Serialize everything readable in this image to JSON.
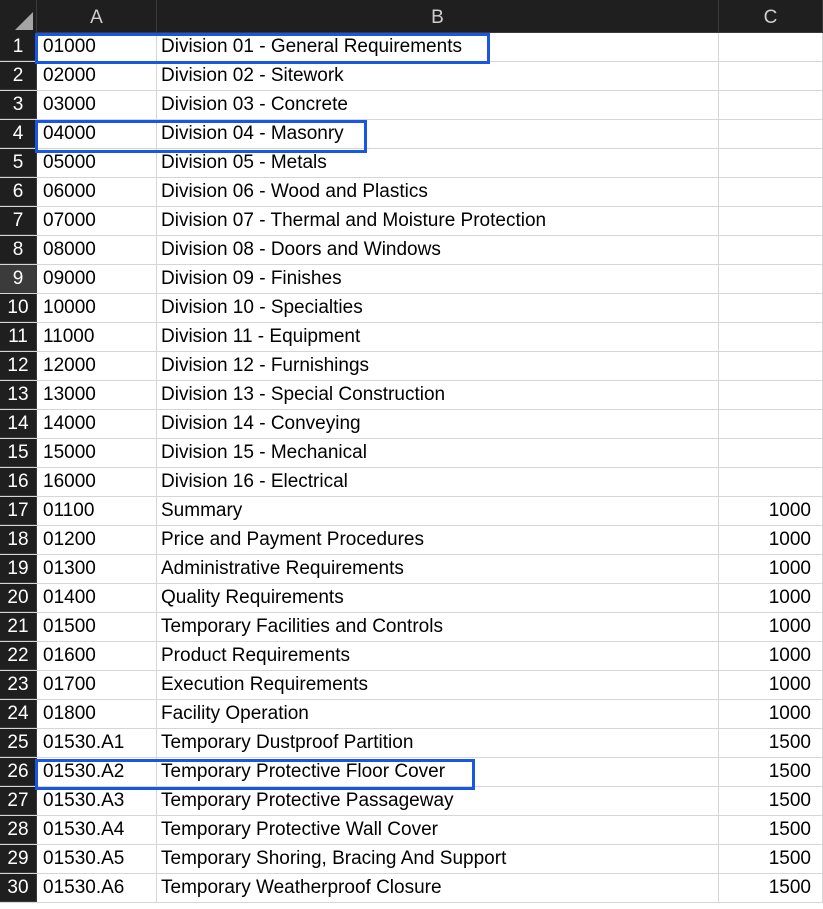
{
  "columns": [
    "A",
    "B",
    "C"
  ],
  "accent_color": "#1857e3",
  "rows": [
    {
      "n": "1",
      "a": "01000",
      "b": "Division 01 - General Requirements",
      "c": ""
    },
    {
      "n": "2",
      "a": "02000",
      "b": "Division 02 - Sitework",
      "c": ""
    },
    {
      "n": "3",
      "a": "03000",
      "b": "Division 03 - Concrete",
      "c": ""
    },
    {
      "n": "4",
      "a": "04000",
      "b": "Division 04 - Masonry",
      "c": ""
    },
    {
      "n": "5",
      "a": "05000",
      "b": "Division 05 - Metals",
      "c": ""
    },
    {
      "n": "6",
      "a": "06000",
      "b": "Division 06 - Wood and Plastics",
      "c": ""
    },
    {
      "n": "7",
      "a": "07000",
      "b": "Division 07 - Thermal and Moisture Protection",
      "c": ""
    },
    {
      "n": "8",
      "a": "08000",
      "b": "Division 08 - Doors and Windows",
      "c": ""
    },
    {
      "n": "9",
      "a": "09000",
      "b": "Division 09 - Finishes",
      "c": ""
    },
    {
      "n": "10",
      "a": "10000",
      "b": "Division 10 - Specialties",
      "c": ""
    },
    {
      "n": "11",
      "a": "11000",
      "b": "Division 11 - Equipment",
      "c": ""
    },
    {
      "n": "12",
      "a": "12000",
      "b": "Division 12 - Furnishings",
      "c": ""
    },
    {
      "n": "13",
      "a": "13000",
      "b": "Division 13 - Special Construction",
      "c": ""
    },
    {
      "n": "14",
      "a": "14000",
      "b": "Division 14 - Conveying",
      "c": ""
    },
    {
      "n": "15",
      "a": "15000",
      "b": "Division 15 - Mechanical",
      "c": ""
    },
    {
      "n": "16",
      "a": "16000",
      "b": "Division 16 - Electrical",
      "c": ""
    },
    {
      "n": "17",
      "a": "01100",
      "b": "Summary",
      "c": "1000"
    },
    {
      "n": "18",
      "a": "01200",
      "b": "Price and Payment Procedures",
      "c": "1000"
    },
    {
      "n": "19",
      "a": "01300",
      "b": "Administrative Requirements",
      "c": "1000"
    },
    {
      "n": "20",
      "a": "01400",
      "b": "Quality Requirements",
      "c": "1000"
    },
    {
      "n": "21",
      "a": "01500",
      "b": "Temporary Facilities and Controls",
      "c": "1000"
    },
    {
      "n": "22",
      "a": "01600",
      "b": "Product Requirements",
      "c": "1000"
    },
    {
      "n": "23",
      "a": "01700",
      "b": "Execution Requirements",
      "c": "1000"
    },
    {
      "n": "24",
      "a": "01800",
      "b": "Facility Operation",
      "c": "1000"
    },
    {
      "n": "25",
      "a": "01530.A1",
      "b": "Temporary Dustproof Partition",
      "c": "1500"
    },
    {
      "n": "26",
      "a": "01530.A2",
      "b": "Temporary Protective Floor Cover",
      "c": "1500"
    },
    {
      "n": "27",
      "a": "01530.A3",
      "b": "Temporary Protective Passageway",
      "c": "1500"
    },
    {
      "n": "28",
      "a": "01530.A4",
      "b": "Temporary Protective Wall Cover",
      "c": "1500"
    },
    {
      "n": "29",
      "a": "01530.A5",
      "b": "Temporary Shoring, Bracing And Support",
      "c": "1500"
    },
    {
      "n": "30",
      "a": "01530.A6",
      "b": "Temporary Weatherproof Closure",
      "c": "1500"
    }
  ]
}
